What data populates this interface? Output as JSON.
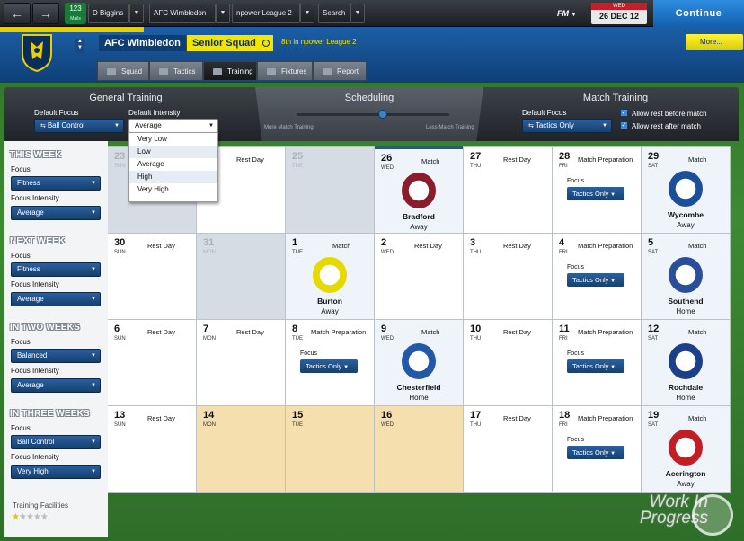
{
  "topbar": {
    "back": "←",
    "fwd": "→",
    "inbox_count": "123",
    "inbox_sub": "Mails",
    "manager": "D Biggins",
    "club": "AFC Wimbledon",
    "competition": "npower League 2",
    "search": "Search",
    "fm": "FM",
    "date_day": "WED",
    "date": "26 DEC 12",
    "continue": "Continue"
  },
  "header": {
    "club": "AFC Wimbledon",
    "squad": "Senior Squad",
    "position": "8th in npower League 2",
    "more": "More..."
  },
  "tabs": [
    "Squad",
    "Tactics",
    "Training",
    "Fixtures",
    "Report"
  ],
  "general": {
    "title": "General Training",
    "focus_label": "Default Focus",
    "focus_value": "Ball Control",
    "intensity_label": "Default Intensity",
    "intensity_value": "Average"
  },
  "scheduling": {
    "title": "Scheduling",
    "left": "More Match Training",
    "right": "Less Match Training",
    "level": 0.55
  },
  "match_training": {
    "title": "Match Training",
    "focus_label": "Default Focus",
    "focus_value": "Tactics Only",
    "rest_before": "Allow rest before match",
    "rest_after": "Allow rest after match"
  },
  "intensity_options": [
    "Very Low",
    "Low",
    "Average",
    "High",
    "Very High"
  ],
  "weeks": [
    {
      "title": "THIS WEEK",
      "focus_label": "Focus",
      "focus": "Fitness",
      "intensity_label": "Focus Intensity",
      "intensity": "Average"
    },
    {
      "title": "NEXT WEEK",
      "focus_label": "Focus",
      "focus": "Fitness",
      "intensity_label": "Focus Intensity",
      "intensity": "Average"
    },
    {
      "title": "IN TWO WEEKS",
      "focus_label": "Focus",
      "focus": "Balanced",
      "intensity_label": "Focus Intensity",
      "intensity": "Average"
    },
    {
      "title": "IN THREE WEEKS",
      "focus_label": "Focus",
      "focus": "Ball Control",
      "intensity_label": "Focus Intensity",
      "intensity": "Very High"
    }
  ],
  "days": [
    [
      {
        "n": "23",
        "d": "SUN",
        "e": "",
        "s": "grey"
      },
      {
        "n": "24",
        "d": "MON",
        "e": "Rest Day",
        "s": ""
      },
      {
        "n": "25",
        "d": "TUE",
        "e": "",
        "s": "grey"
      },
      {
        "n": "26",
        "d": "WED",
        "e": "Match",
        "s": "match cur",
        "opp": "Bradford",
        "ha": "Away",
        "col": "#8a1c2c"
      },
      {
        "n": "27",
        "d": "THU",
        "e": "Rest Day",
        "s": ""
      },
      {
        "n": "28",
        "d": "FRI",
        "e": "Match Preparation",
        "s": "",
        "f": "Tactics Only"
      },
      {
        "n": "29",
        "d": "SAT",
        "e": "Match",
        "s": "match",
        "opp": "Wycombe",
        "ha": "Away",
        "col": "#1b4f9a"
      }
    ],
    [
      {
        "n": "30",
        "d": "SUN",
        "e": "Rest Day",
        "s": ""
      },
      {
        "n": "31",
        "d": "MON",
        "e": "",
        "s": "grey"
      },
      {
        "n": "1",
        "d": "TUE",
        "e": "Match",
        "s": "match",
        "opp": "Burton",
        "ha": "Away",
        "col": "#e6d900"
      },
      {
        "n": "2",
        "d": "WED",
        "e": "Rest Day",
        "s": ""
      },
      {
        "n": "3",
        "d": "THU",
        "e": "Rest Day",
        "s": ""
      },
      {
        "n": "4",
        "d": "FRI",
        "e": "Match Preparation",
        "s": "",
        "f": "Tactics Only"
      },
      {
        "n": "5",
        "d": "SAT",
        "e": "Match",
        "s": "match",
        "opp": "Southend",
        "ha": "Home",
        "col": "#2a4f9a"
      }
    ],
    [
      {
        "n": "6",
        "d": "SUN",
        "e": "Rest Day",
        "s": ""
      },
      {
        "n": "7",
        "d": "MON",
        "e": "Rest Day",
        "s": ""
      },
      {
        "n": "8",
        "d": "TUE",
        "e": "Match Preparation",
        "s": "",
        "f": "Tactics Only"
      },
      {
        "n": "9",
        "d": "WED",
        "e": "Match",
        "s": "match",
        "opp": "Chesterfield",
        "ha": "Home",
        "col": "#2258a8"
      },
      {
        "n": "10",
        "d": "THU",
        "e": "Rest Day",
        "s": ""
      },
      {
        "n": "11",
        "d": "FRI",
        "e": "Match Preparation",
        "s": "",
        "f": "Tactics Only"
      },
      {
        "n": "12",
        "d": "SAT",
        "e": "Match",
        "s": "match",
        "opp": "Rochdale",
        "ha": "Home",
        "col": "#1c3f8a"
      }
    ],
    [
      {
        "n": "13",
        "d": "SUN",
        "e": "Rest Day",
        "s": ""
      },
      {
        "n": "14",
        "d": "MON",
        "e": "",
        "s": "tan"
      },
      {
        "n": "15",
        "d": "TUE",
        "e": "",
        "s": "tan"
      },
      {
        "n": "16",
        "d": "WED",
        "e": "",
        "s": "tan"
      },
      {
        "n": "17",
        "d": "THU",
        "e": "Rest Day",
        "s": ""
      },
      {
        "n": "18",
        "d": "FRI",
        "e": "Match Preparation",
        "s": "",
        "f": "Tactics Only"
      },
      {
        "n": "19",
        "d": "SAT",
        "e": "Match",
        "s": "match",
        "opp": "Accrington",
        "ha": "Away",
        "col": "#c21e24"
      }
    ]
  ],
  "match_focus_label": "Focus",
  "facilities": {
    "label": "Training Facilities",
    "rating": 1,
    "max": 5
  },
  "watermark": "Work In Progress",
  "colors": {
    "accent": "#1260b0",
    "yellow": "#f2e600",
    "tan": "#f6dfae",
    "grey": "#d6dce3"
  }
}
